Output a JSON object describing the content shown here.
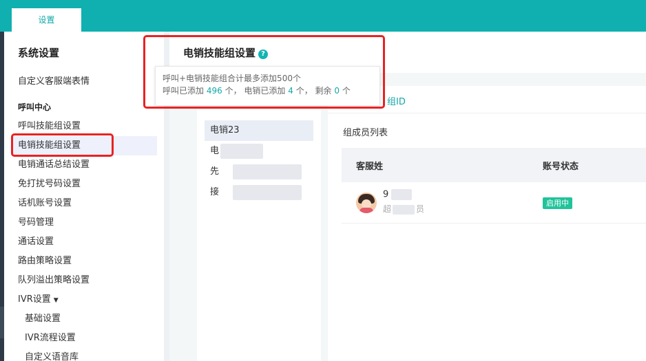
{
  "topbar": {
    "tab_label": "设置"
  },
  "sidebar": {
    "title": "系统设置",
    "link_top": "自定义客服端表情",
    "section": "呼叫中心",
    "items": [
      {
        "label": "呼叫技能组设置"
      },
      {
        "label": "电销技能组设置"
      },
      {
        "label": "电销通话总结设置"
      },
      {
        "label": "免打扰号码设置"
      },
      {
        "label": "话机账号设置"
      },
      {
        "label": "号码管理"
      },
      {
        "label": "通话设置"
      },
      {
        "label": "路由策略设置"
      },
      {
        "label": "队列溢出策略设置"
      },
      {
        "label": "IVR设置"
      },
      {
        "label": "基础设置"
      },
      {
        "label": "IVR流程设置"
      },
      {
        "label": "自定义语音库"
      }
    ]
  },
  "main": {
    "page_title": "电销技能组设置",
    "help_glyph": "?",
    "tooltip": {
      "line1": "呼叫+电销技能组合计最多添加500个",
      "l2_a": "呼叫已添加",
      "l2_n1": "496",
      "l2_b": "个，  电销已添加",
      "l2_n2": "4",
      "l2_c": "个，  剩余",
      "l2_n3": "0",
      "l2_d": "个"
    },
    "groups": [
      {
        "label": "电销23"
      },
      {
        "label": "电"
      },
      {
        "label": "先"
      },
      {
        "label": "接"
      }
    ],
    "detail": {
      "id_label": "组ID",
      "list_title": "组成员列表",
      "col_agent": "客服姓",
      "col_status": "账号状态",
      "rows": [
        {
          "name": "9",
          "role": "超",
          "role_suffix": "员",
          "status": "启用中"
        }
      ]
    }
  },
  "colors": {
    "accent": "#10b0b0",
    "highlight_box": "#e82222",
    "status_green": "#21c39a"
  }
}
